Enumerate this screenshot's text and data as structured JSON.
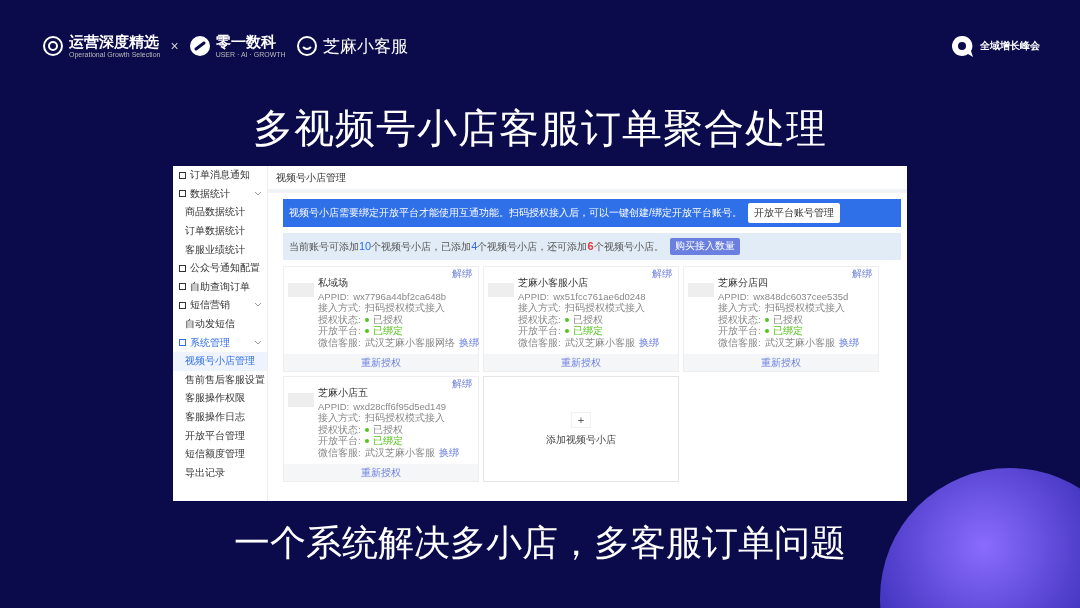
{
  "header": {
    "logos": [
      {
        "kind": "ring",
        "name": "运营深度精选",
        "tagline": "Operational Growth Selection"
      },
      {
        "kind": "separator",
        "name": "×"
      },
      {
        "kind": "link",
        "name": "零一数科",
        "tagline": "USER · AI · GROWTH"
      },
      {
        "kind": "smile",
        "name": "芝麻小客服"
      }
    ],
    "event": {
      "name": "全域增长峰会"
    }
  },
  "title": "多视频号小店客服订单聚合处理",
  "app": {
    "sidebar": {
      "items": [
        {
          "label": "订单消息通知",
          "selected": false
        },
        {
          "label": "数据统计",
          "selected": false,
          "expanded": true,
          "children": [
            {
              "label": "商品数据统计",
              "selected": false
            },
            {
              "label": "订单数据统计",
              "selected": false
            },
            {
              "label": "客服业绩统计",
              "selected": false
            }
          ]
        },
        {
          "label": "公众号通知配置",
          "selected": false
        },
        {
          "label": "自助查询订单",
          "selected": false
        },
        {
          "label": "短信营销",
          "selected": false,
          "expanded": true,
          "children": [
            {
              "label": "自动发短信",
              "selected": false
            }
          ]
        },
        {
          "label": "系统管理",
          "selected": true,
          "expanded": true,
          "children": [
            {
              "label": "视频号小店管理",
              "selected": true
            },
            {
              "label": "售前售后客服设置",
              "selected": false
            },
            {
              "label": "客服操作权限",
              "selected": false
            },
            {
              "label": "客服操作日志",
              "selected": false
            },
            {
              "label": "开放平台管理",
              "selected": false
            },
            {
              "label": "短信额度管理",
              "selected": false
            },
            {
              "label": "导出记录",
              "selected": false
            }
          ]
        }
      ]
    },
    "page_title": "视频号小店管理",
    "banner": {
      "text": "视频号小店需要绑定开放平台才能使用互通功能。扫码授权接入后，可以一键创建/绑定开放平台账号。",
      "button": "开放平台账号管理"
    },
    "quota": {
      "parts": [
        {
          "kind": "text",
          "text": "当前账号可添加"
        },
        {
          "kind": "number",
          "text": "10"
        },
        {
          "kind": "text",
          "text": "个视频号小店，已添加"
        },
        {
          "kind": "number",
          "text": "4"
        },
        {
          "kind": "text",
          "text": "个视频号小店，还可添加"
        },
        {
          "kind": "warning",
          "text": "6"
        },
        {
          "kind": "text",
          "text": "个视频号小店。"
        }
      ],
      "button": "购买接入数量"
    },
    "shops": [
      {
        "name": "私域场",
        "unbind": "解绑",
        "appid_label": "APPID:",
        "appid": "wx7796a44bf2ca648b",
        "mode_label": "接入方式:",
        "mode": "扫码授权模式接入",
        "auth_label": "授权状态:",
        "auth": "已授权",
        "platform_label": "开放平台:",
        "platform": "已绑定",
        "service_label": "微信客服:",
        "service": "武汉芝麻小客服网络",
        "rebind": "换绑",
        "button": "重新授权"
      },
      {
        "name": "芝麻小客服小店",
        "unbind": "解绑",
        "appid_label": "APPID:",
        "appid": "wx51fcc761ae6d0248",
        "mode_label": "接入方式:",
        "mode": "扫码授权模式接入",
        "auth_label": "授权状态:",
        "auth": "已授权",
        "platform_label": "开放平台:",
        "platform": "已绑定",
        "service_label": "微信客服:",
        "service": "武汉芝麻小客服",
        "rebind": "换绑",
        "button": "重新授权"
      },
      {
        "name": "芝麻分店四",
        "unbind": "解绑",
        "appid_label": "APPID:",
        "appid": "wx848dc6037cee535d",
        "mode_label": "接入方式:",
        "mode": "扫码授权模式接入",
        "auth_label": "授权状态:",
        "auth": "已授权",
        "platform_label": "开放平台:",
        "platform": "已绑定",
        "service_label": "微信客服:",
        "service": "武汉芝麻小客服",
        "rebind": "换绑",
        "button": "重新授权"
      },
      {
        "name": "芝麻小店五",
        "unbind": "解绑",
        "appid_label": "APPID:",
        "appid": "wxd28cff6f95d5ed149",
        "mode_label": "接入方式:",
        "mode": "扫码授权模式接入",
        "auth_label": "授权状态:",
        "auth": "已授权",
        "platform_label": "开放平台:",
        "platform": "已绑定",
        "service_label": "微信客服:",
        "service": "武汉芝麻小客服",
        "rebind": "换绑",
        "button": "重新授权"
      }
    ],
    "add_card": {
      "icon": "+",
      "label": "添加视频号小店"
    }
  },
  "subtitle": "一个系统解决多小店，多客服订单问题"
}
